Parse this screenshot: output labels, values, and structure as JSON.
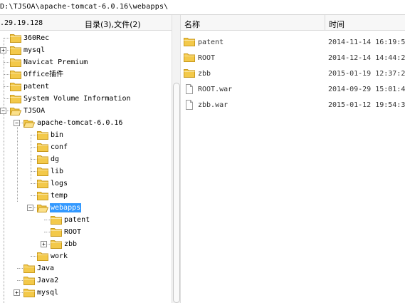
{
  "path_bar": {
    "text": "D:\\TJSOA\\apache-tomcat-6.0.16\\webapps\\"
  },
  "left_header": {
    "ip": ".29.19.128",
    "summary": "目录(3),文件(2)"
  },
  "tree": [
    {
      "label": "360Rec"
    },
    {
      "label": "mysql"
    },
    {
      "label": "Navicat Premium"
    },
    {
      "label": "Office插件"
    },
    {
      "label": "patent"
    },
    {
      "label": "System Volume Information"
    },
    {
      "label": "TJSOA"
    },
    {
      "label": "apache-tomcat-6.0.16"
    },
    {
      "label": "bin"
    },
    {
      "label": "conf"
    },
    {
      "label": "dg"
    },
    {
      "label": "lib"
    },
    {
      "label": "logs"
    },
    {
      "label": "temp"
    },
    {
      "label": "webapps",
      "selected": true
    },
    {
      "label": "patent"
    },
    {
      "label": "ROOT"
    },
    {
      "label": "zbb"
    },
    {
      "label": "work"
    },
    {
      "label": "Java"
    },
    {
      "label": "Java2"
    },
    {
      "label": "mysql"
    }
  ],
  "file_columns": {
    "name": "名称",
    "time": "时间"
  },
  "files": [
    {
      "name": "patent",
      "time": "2014-11-14 16:19:5",
      "icon": "folder-icon"
    },
    {
      "name": "ROOT",
      "time": "2014-12-14 14:44:2",
      "icon": "folder-icon"
    },
    {
      "name": "zbb",
      "time": "2015-01-19 12:37:2",
      "icon": "folder-icon"
    },
    {
      "name": "ROOT.war",
      "time": "2014-09-29 15:01:4",
      "icon": "file-icon"
    },
    {
      "name": "zbb.war",
      "time": "2015-01-12 19:54:3",
      "icon": "file-icon"
    }
  ],
  "colors": {
    "folder": "#f3c94a",
    "folder_dark": "#c99a1e",
    "selection": "#3399ff"
  }
}
